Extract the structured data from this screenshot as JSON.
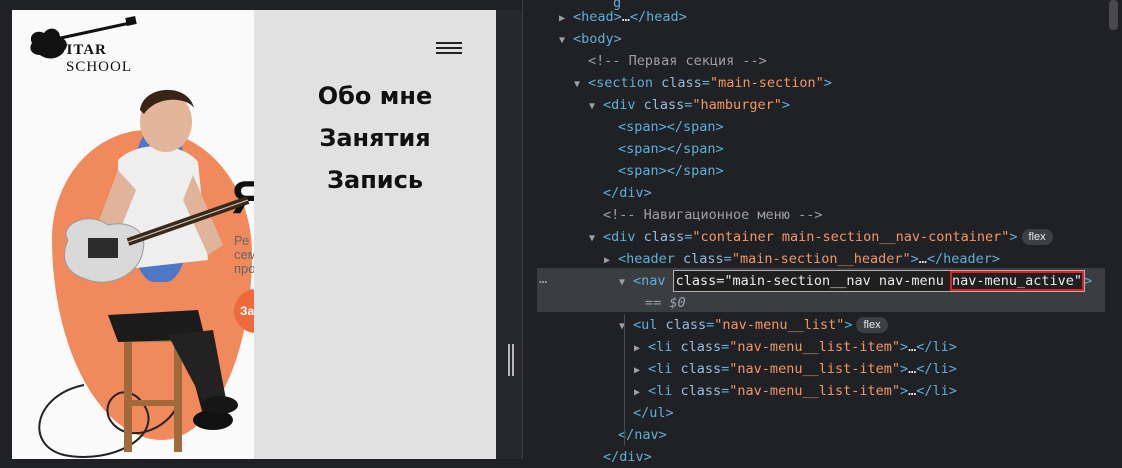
{
  "site": {
    "logo_line1": "GUITAR",
    "logo_line2": "SCHOOL",
    "hero_big_letter": "Я",
    "hero_text_lines": [
      "Ре",
      "сем",
      "про"
    ],
    "hero_button": "За",
    "menu": [
      "Обо мне",
      "Занятия",
      "Запись"
    ]
  },
  "devtools": {
    "lines": [
      {
        "indent": 0,
        "arrow": "▶",
        "parts": [
          [
            "tag",
            "<head>"
          ],
          [
            "txt",
            "…"
          ],
          [
            "tag",
            "</head>"
          ]
        ]
      },
      {
        "indent": 0,
        "arrow": "▼",
        "parts": [
          [
            "tag",
            "<body>"
          ]
        ]
      },
      {
        "indent": 1,
        "arrow": "",
        "parts": [
          [
            "cmt",
            "<!-- Первая секция -->"
          ]
        ]
      },
      {
        "indent": 1,
        "arrow": "▼",
        "parts": [
          [
            "tag",
            "<section "
          ],
          [
            "attr",
            "class"
          ],
          [
            "tag",
            "="
          ],
          [
            "val",
            "\"main-section\""
          ],
          [
            "tag",
            ">"
          ]
        ]
      },
      {
        "indent": 2,
        "arrow": "▼",
        "parts": [
          [
            "tag",
            "<div "
          ],
          [
            "attr",
            "class"
          ],
          [
            "tag",
            "="
          ],
          [
            "val",
            "\"hamburger\""
          ],
          [
            "tag",
            ">"
          ]
        ]
      },
      {
        "indent": 3,
        "arrow": "",
        "parts": [
          [
            "tag",
            "<span></span>"
          ]
        ]
      },
      {
        "indent": 3,
        "arrow": "",
        "parts": [
          [
            "tag",
            "<span></span>"
          ]
        ]
      },
      {
        "indent": 3,
        "arrow": "",
        "parts": [
          [
            "tag",
            "<span></span>"
          ]
        ]
      },
      {
        "indent": 2,
        "arrow": "",
        "parts": [
          [
            "tag",
            "</div>"
          ]
        ]
      },
      {
        "indent": 2,
        "arrow": "",
        "parts": [
          [
            "cmt",
            "<!-- Навигационное меню -->"
          ]
        ]
      },
      {
        "indent": 2,
        "arrow": "▼",
        "parts": [
          [
            "tag",
            "<div "
          ],
          [
            "attr",
            "class"
          ],
          [
            "tag",
            "="
          ],
          [
            "val",
            "\"container main-section__nav-container\""
          ],
          [
            "tag",
            ">"
          ]
        ],
        "badge": "flex"
      },
      {
        "indent": 3,
        "arrow": "▶",
        "parts": [
          [
            "tag",
            "<header "
          ],
          [
            "attr",
            "class"
          ],
          [
            "tag",
            "="
          ],
          [
            "val",
            "\"main-section__header\""
          ],
          [
            "tag",
            ">"
          ],
          [
            "txt",
            "…"
          ],
          [
            "tag",
            "</header>"
          ]
        ]
      }
    ],
    "selected_line": {
      "tag_open": "<nav",
      "attr_text": "class=\"main-section__nav nav-menu",
      "highlight_text": "nav-menu_active\"",
      "tag_close": ">",
      "eq_text": "== $0",
      "dots": "…"
    },
    "lines_after": [
      {
        "indent": 4,
        "arrow": "▼",
        "parts": [
          [
            "tag",
            "<ul "
          ],
          [
            "attr",
            "class"
          ],
          [
            "tag",
            "="
          ],
          [
            "val",
            "\"nav-menu__list\""
          ],
          [
            "tag",
            ">"
          ]
        ],
        "badge": "flex"
      },
      {
        "indent": 5,
        "arrow": "▶",
        "parts": [
          [
            "tag",
            "<li "
          ],
          [
            "attr",
            "class"
          ],
          [
            "tag",
            "="
          ],
          [
            "val",
            "\"nav-menu__list-item\""
          ],
          [
            "tag",
            ">"
          ],
          [
            "txt",
            "…"
          ],
          [
            "tag",
            "</li>"
          ]
        ]
      },
      {
        "indent": 5,
        "arrow": "▶",
        "parts": [
          [
            "tag",
            "<li "
          ],
          [
            "attr",
            "class"
          ],
          [
            "tag",
            "="
          ],
          [
            "val",
            "\"nav-menu__list-item\""
          ],
          [
            "tag",
            ">"
          ],
          [
            "txt",
            "…"
          ],
          [
            "tag",
            "</li>"
          ]
        ]
      },
      {
        "indent": 5,
        "arrow": "▶",
        "parts": [
          [
            "tag",
            "<li "
          ],
          [
            "attr",
            "class"
          ],
          [
            "tag",
            "="
          ],
          [
            "val",
            "\"nav-menu__list-item\""
          ],
          [
            "tag",
            ">"
          ],
          [
            "txt",
            "…"
          ],
          [
            "tag",
            "</li>"
          ]
        ]
      },
      {
        "indent": 4,
        "arrow": "",
        "parts": [
          [
            "tag",
            "</ul>"
          ]
        ]
      },
      {
        "indent": 3,
        "arrow": "",
        "parts": [
          [
            "tag",
            "</nav>"
          ]
        ]
      },
      {
        "indent": 2,
        "arrow": "",
        "parts": [
          [
            "tag",
            "</div>"
          ]
        ]
      }
    ]
  }
}
